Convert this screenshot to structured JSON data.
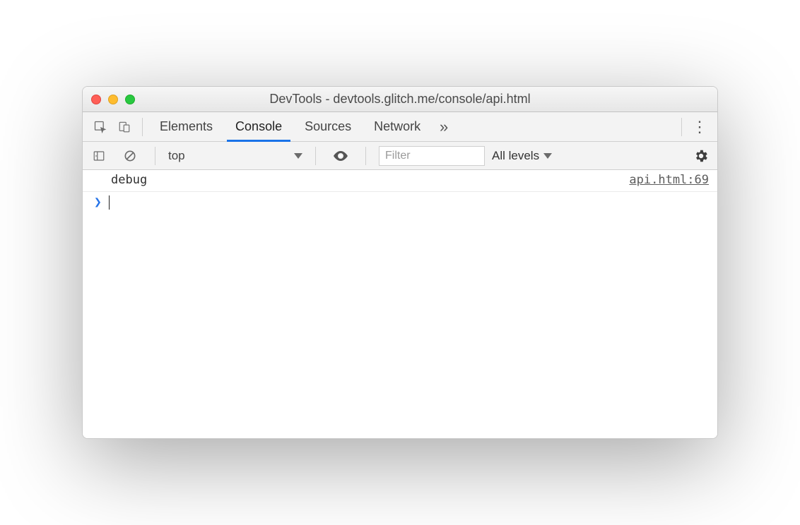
{
  "window": {
    "title": "DevTools - devtools.glitch.me/console/api.html"
  },
  "tabs": {
    "items": [
      {
        "label": "Elements"
      },
      {
        "label": "Console"
      },
      {
        "label": "Sources"
      },
      {
        "label": "Network"
      }
    ],
    "active_index": 1,
    "more_glyph": "»",
    "menu_glyph": "⋮"
  },
  "console_toolbar": {
    "context": "top",
    "filter_placeholder": "Filter",
    "levels_label": "All levels"
  },
  "console": {
    "messages": [
      {
        "text": "debug",
        "source": "api.html:69"
      }
    ],
    "prompt_glyph": "❯"
  }
}
